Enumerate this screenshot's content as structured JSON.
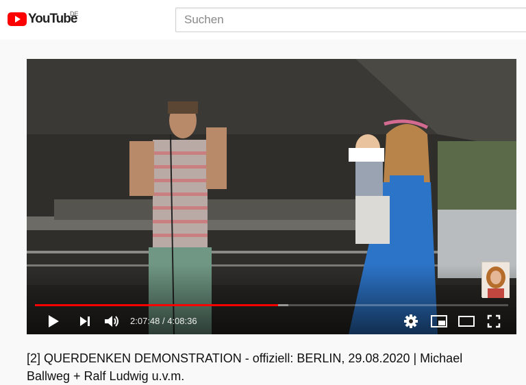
{
  "header": {
    "logo_text": "YouTube",
    "country_code": "DE",
    "search_placeholder": "Suchen"
  },
  "player": {
    "current_time": "2:07:48",
    "time_separator": " / ",
    "duration": "4:08:36",
    "progress_played": 0.514,
    "progress_loaded": 0.535,
    "accent_color": "#ff0000"
  },
  "icons": [
    "play-icon",
    "next-icon",
    "volume-icon",
    "settings-icon",
    "miniplayer-icon",
    "theater-icon",
    "fullscreen-icon"
  ],
  "video": {
    "title": "[2] QUERDENKEN DEMONSTRATION - offiziell: BERLIN, 29.08.2020 | Michael Ballweg + Ralf Ludwig u.v.m."
  }
}
